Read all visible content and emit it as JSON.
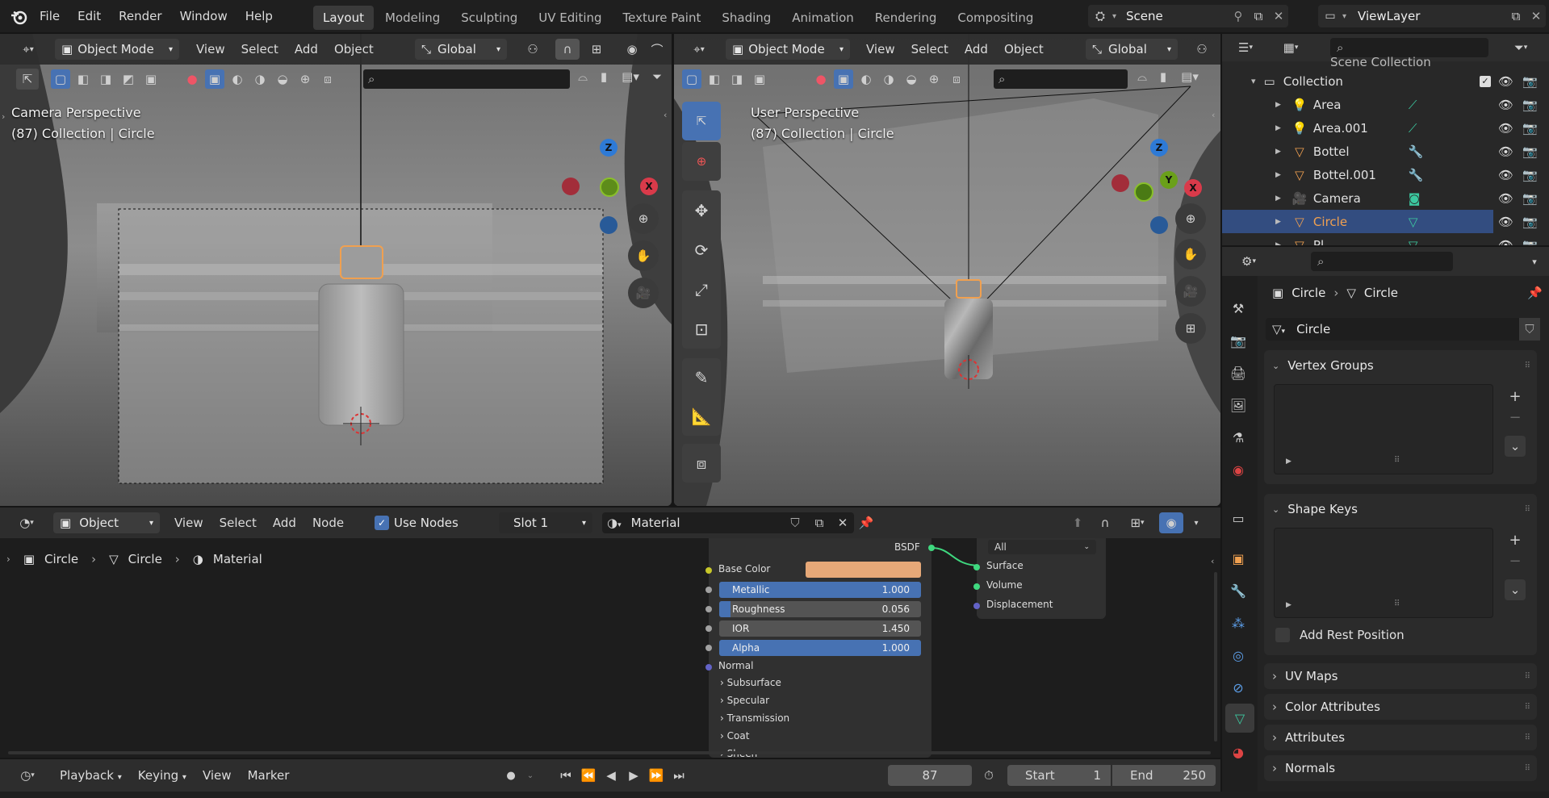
{
  "topbar": {
    "menus": [
      "File",
      "Edit",
      "Render",
      "Window",
      "Help"
    ],
    "workspaces": [
      "Layout",
      "Modeling",
      "Sculpting",
      "UV Editing",
      "Texture Paint",
      "Shading",
      "Animation",
      "Rendering",
      "Compositing"
    ],
    "active_workspace": "Layout",
    "scene": "Scene",
    "view_layer": "ViewLayer"
  },
  "viewport_left": {
    "mode": "Object Mode",
    "menus": [
      "View",
      "Select",
      "Add",
      "Object"
    ],
    "orientation": "Global",
    "title": "Camera Perspective",
    "subtitle": "(87) Collection | Circle"
  },
  "viewport_right": {
    "mode": "Object Mode",
    "menus": [
      "View",
      "Select",
      "Add",
      "Object"
    ],
    "orientation": "Global",
    "title": "User Perspective",
    "subtitle": "(87) Collection | Circle"
  },
  "gizmo": {
    "z": "Z",
    "x": "X",
    "y": "Y"
  },
  "outliner": {
    "header": "Scene Collection",
    "collection": "Collection",
    "items": [
      {
        "name": "Area",
        "icon": "light-icon",
        "extra": "light-data-icon",
        "selected": false
      },
      {
        "name": "Area.001",
        "icon": "light-icon",
        "extra": "light-data-icon",
        "selected": false
      },
      {
        "name": "Bottel",
        "icon": "mesh-icon",
        "extra": "modifier-wrench-icon",
        "selected": false
      },
      {
        "name": "Bottel.001",
        "icon": "mesh-icon",
        "extra": "modifier-wrench-icon",
        "selected": false
      },
      {
        "name": "Camera",
        "icon": "camera-icon",
        "extra": "camera-data-icon",
        "selected": false
      },
      {
        "name": "Circle",
        "icon": "mesh-icon",
        "extra": "mesh-data-icon",
        "selected": true
      },
      {
        "name": "Pl...",
        "icon": "mesh-icon",
        "extra": "mesh-data-icon",
        "selected": false
      }
    ]
  },
  "properties": {
    "breadcrumb_object": "Circle",
    "breadcrumb_data": "Circle",
    "data_name": "Circle",
    "panels": {
      "vertex_groups": "Vertex Groups",
      "shape_keys": "Shape Keys",
      "add_rest_position": "Add Rest Position",
      "uv_maps": "UV Maps",
      "color_attributes": "Color Attributes",
      "attributes": "Attributes",
      "normals": "Normals"
    }
  },
  "node_editor": {
    "editor_type": "Object",
    "menus": [
      "View",
      "Select",
      "Add",
      "Node"
    ],
    "use_nodes_label": "Use Nodes",
    "slot": "Slot 1",
    "material": "Material",
    "breadcrumb": [
      "Circle",
      "Circle",
      "Material"
    ],
    "bsdf_label": "BSDF",
    "inputs": {
      "base_color": "Base Color",
      "metallic_label": "Metallic",
      "metallic_value": "1.000",
      "roughness_label": "Roughness",
      "roughness_value": "0.056",
      "ior_label": "IOR",
      "ior_value": "1.450",
      "alpha_label": "Alpha",
      "alpha_value": "1.000",
      "normal": "Normal"
    },
    "roughness_fraction": 0.056,
    "subpanels": [
      "Subsurface",
      "Specular",
      "Transmission",
      "Coat",
      "Sheen"
    ],
    "output": {
      "target": "All",
      "surface": "Surface",
      "volume": "Volume",
      "displacement": "Displacement"
    }
  },
  "timeline": {
    "menus": [
      "Playback",
      "Keying",
      "View",
      "Marker"
    ],
    "frame": "87",
    "start_label": "Start",
    "start": "1",
    "end_label": "End",
    "end": "250"
  },
  "colors": {
    "accent_blue": "#4772b3",
    "selected_orange": "#f0a050",
    "base_color": "#e6a878",
    "axis_x": "#d93a4a",
    "axis_y": "#6aa01a",
    "axis_z": "#2e7ad6"
  }
}
